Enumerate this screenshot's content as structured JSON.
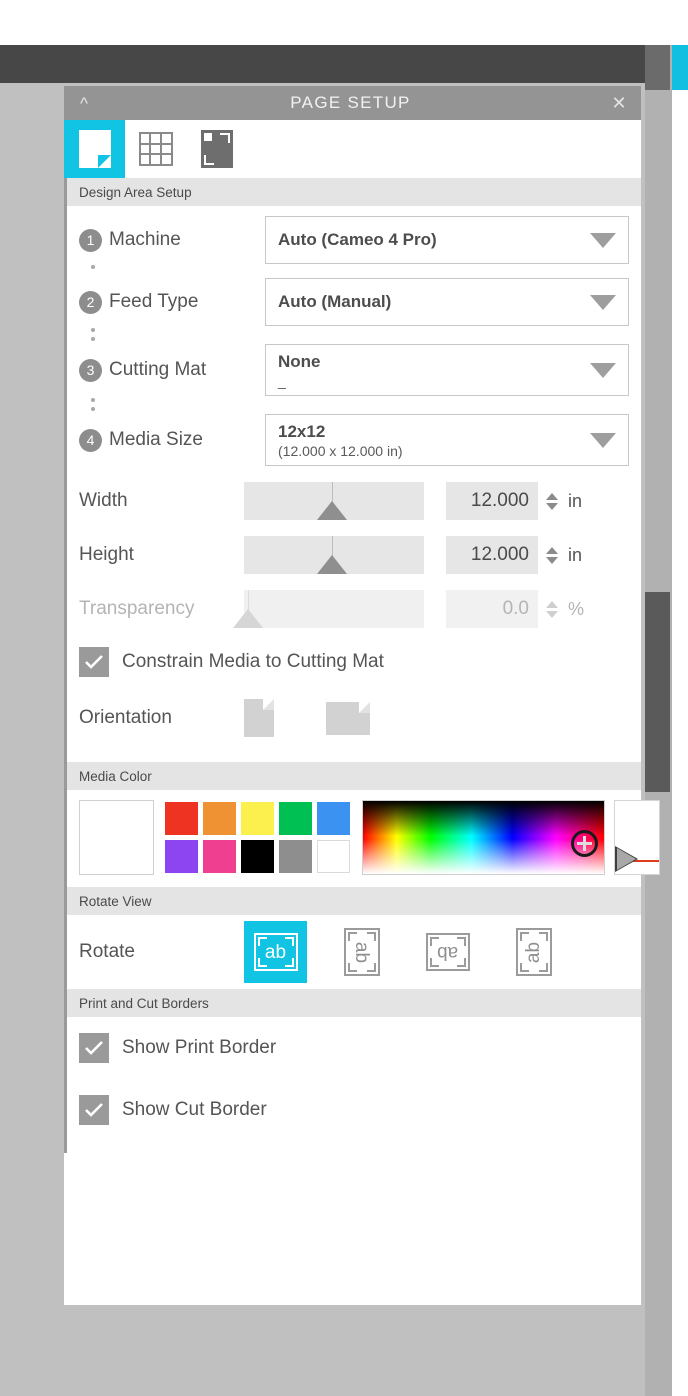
{
  "panel": {
    "title": "PAGE SETUP",
    "collapse_icon": "chevron-up-icon",
    "close_icon": "close-icon",
    "tabs": [
      {
        "name": "page-tab",
        "icon": "page-icon",
        "active": true
      },
      {
        "name": "grid-tab",
        "icon": "grid-icon",
        "active": false
      },
      {
        "name": "registration-marks-tab",
        "icon": "mat-icon",
        "active": false
      }
    ]
  },
  "sections": {
    "design_area": {
      "header": "Design Area Setup",
      "fields": [
        {
          "badge": "1",
          "label": "Machine",
          "value": "Auto (Cameo 4 Pro)",
          "sub": ""
        },
        {
          "badge": "2",
          "label": "Feed Type",
          "value": "Auto (Manual)",
          "sub": ""
        },
        {
          "badge": "3",
          "label": "Cutting Mat",
          "value": "None",
          "sub": "_"
        },
        {
          "badge": "4",
          "label": "Media Size",
          "value": "12x12",
          "sub": "(12.000 x 12.000 in)"
        }
      ],
      "sliders": [
        {
          "label": "Width",
          "value": "12.000",
          "unit": "in",
          "thumb_pct": 48,
          "disabled": false
        },
        {
          "label": "Height",
          "value": "12.000",
          "unit": "in",
          "thumb_pct": 48,
          "disabled": false
        },
        {
          "label": "Transparency",
          "value": "0.0",
          "unit": "%",
          "thumb_pct": 2,
          "disabled": true
        }
      ],
      "constrain_checkbox": {
        "label": "Constrain Media to Cutting Mat",
        "checked": true
      },
      "orientation": {
        "label": "Orientation",
        "options": [
          "portrait-page-icon",
          "landscape-page-icon"
        ]
      }
    },
    "media_color": {
      "header": "Media Color",
      "current_swatch": "#ffffff",
      "palette": [
        "#ee3322",
        "#ef9233",
        "#fbf04e",
        "#00bf53",
        "#3c92f0",
        "#8c45f0",
        "#ee3f91",
        "#000000",
        "#8e8e8e",
        "#ffffff"
      ],
      "picker": {
        "name": "color-gradient-picker",
        "marker": "crosshair-icon"
      },
      "alpha": {
        "name": "alpha-slider",
        "value_line_color": "#e03c1a"
      }
    },
    "rotate_view": {
      "header": "Rotate View",
      "label": "Rotate",
      "options": [
        {
          "name": "rotate-0-button",
          "text": "ab",
          "rotation": 0,
          "active": true
        },
        {
          "name": "rotate-90-button",
          "text": "ab",
          "rotation": 90,
          "active": false
        },
        {
          "name": "rotate-180-button",
          "text": "ab",
          "rotation": 180,
          "active": false
        },
        {
          "name": "rotate-270-button",
          "text": "ab",
          "rotation": 270,
          "active": false
        }
      ]
    },
    "borders": {
      "header": "Print and Cut Borders",
      "checkboxes": [
        {
          "label": "Show Print Border",
          "checked": true
        },
        {
          "label": "Show Cut Border",
          "checked": true
        }
      ]
    }
  },
  "colors": {
    "accent": "#11c4e3",
    "panel_header": "#949494",
    "section_header": "#e4e4e4",
    "canvas": "#c0c0c0",
    "topbar": "#474747"
  }
}
